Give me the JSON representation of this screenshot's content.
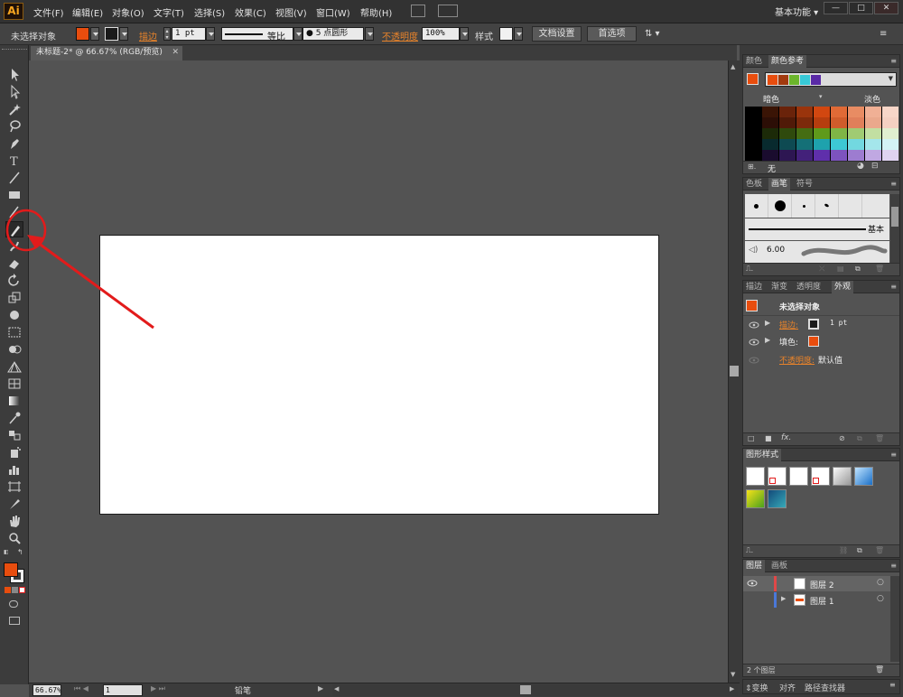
{
  "app": {
    "logo": "Ai"
  },
  "menu": [
    "文件(F)",
    "编辑(E)",
    "对象(O)",
    "文字(T)",
    "选择(S)",
    "效果(C)",
    "视图(V)",
    "窗口(W)",
    "帮助(H)"
  ],
  "workspace": {
    "label": "基本功能 ▾"
  },
  "window_controls": {
    "minimize": "—",
    "maximize": "□",
    "close": "✕"
  },
  "control_bar": {
    "selection": "未选择对象",
    "stroke_label": "描边",
    "stroke_weight": "1 pt",
    "profile_label": "等比",
    "brush_label": "5 点圆形",
    "opacity_label": "不透明度",
    "opacity_value": "100%",
    "style_label": "样式",
    "doc_setup": "文档设置",
    "preferences": "首选项"
  },
  "document": {
    "tab_title": "未标题-2* @ 66.67% (RGB/预览)",
    "close": "✕"
  },
  "status_bar": {
    "zoom": "66.67%",
    "page": "1",
    "tool_name": "铅笔"
  },
  "colors": {
    "fill": "#e84d0e",
    "accent": "#e8832a",
    "annotation": "#e21b1b"
  },
  "panels": {
    "color_tabs": [
      "颜色",
      "颜色参考"
    ],
    "harmony_left": "暗色",
    "harmony_right": "淡色",
    "none_label": "无",
    "brush_tabs": [
      "色板",
      "画笔",
      "符号"
    ],
    "brush_basic": "基本",
    "brush_size": "6.00",
    "appearance_tabs": [
      "描边",
      "渐变",
      "透明度",
      "外观"
    ],
    "appearance_title": "未选择对象",
    "appearance_stroke": "描边:",
    "appearance_stroke_value": "1 pt",
    "appearance_fill": "填色:",
    "appearance_opacity": "不透明度:",
    "appearance_opacity_value": "默认值",
    "graphic_styles_tab": "图形样式",
    "layers_tabs": [
      "图层",
      "画板"
    ],
    "layers": [
      {
        "name": "图层 2",
        "color": "#e04848"
      },
      {
        "name": "图层 1",
        "color": "#4a78d8"
      }
    ],
    "layers_count": "2 个图层",
    "bottom_tabs": [
      "变换",
      "对齐",
      "路径查找器"
    ]
  }
}
